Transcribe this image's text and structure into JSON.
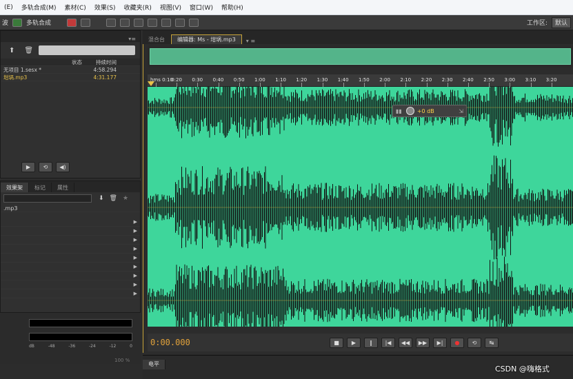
{
  "menu": [
    "(E)",
    "多轨合成(M)",
    "素材(C)",
    "效果(S)",
    "收藏夹(R)",
    "视图(V)",
    "窗口(W)",
    "帮助(H)"
  ],
  "toolbar": {
    "waveform_label": "波",
    "multitrack_label": "多轨合成",
    "workspace_label": "工作区:",
    "workspace_value": "默认"
  },
  "files_panel": {
    "col_status": "状态",
    "col_duration": "持续时间",
    "files": [
      {
        "name": "无项目 1.sesx *",
        "duration": "4:58.294"
      },
      {
        "name": "坩埚.mp3",
        "duration": "4:31.177"
      }
    ]
  },
  "effects_panel": {
    "tabs": [
      "效果架",
      "标记",
      "属性"
    ],
    "file_label": ".mp3"
  },
  "editor_tabs": {
    "mixer": "混合台",
    "editor": "编辑器: Ms - 坩埚.mp3"
  },
  "ruler": {
    "ticks": [
      "hms 0:10",
      "0:20",
      "0:30",
      "0:40",
      "0:50",
      "1:00",
      "1:10",
      "1:20",
      "1:30",
      "1:40",
      "1:50",
      "2:00",
      "2:10",
      "2:20",
      "2:30",
      "2:40",
      "2:50",
      "3:00",
      "3:10",
      "3:20"
    ]
  },
  "hud": {
    "value": "+0 dB"
  },
  "transport": {
    "timecode": "0:00.000"
  },
  "levels": {
    "scale": [
      "dB",
      "-48",
      "-36",
      "-24",
      "-12",
      "0"
    ],
    "label_percent": "100 %"
  },
  "bottom_tab": "电平",
  "watermark": "CSDN @嗨格式",
  "colors": {
    "waveform_bg": "#3ed69b",
    "waveform": "#111111",
    "timecode": "#e2a23b"
  }
}
